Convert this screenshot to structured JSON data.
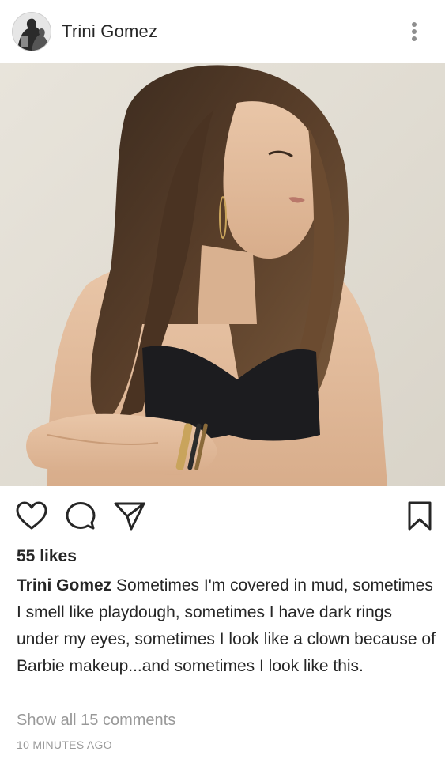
{
  "post": {
    "username": "Trini Gomez",
    "likes": "55 likes",
    "caption_user": "Trini Gomez",
    "caption_text": " Sometimes I'm covered in mud, sometimes I smell like playdough, sometimes I have dark rings under my eyes, sometimes I look like a clown because of Barbie makeup...and sometimes I look like this.",
    "comments_link": "Show all 15 comments",
    "timestamp": "10 MINUTES AGO"
  },
  "icons": {
    "more": "more-vertical-icon",
    "like": "heart-icon",
    "comment": "comment-bubble-icon",
    "share": "paper-plane-icon",
    "save": "bookmark-icon"
  },
  "colors": {
    "text": "#262626",
    "secondary_text": "#999999",
    "background": "#ffffff"
  }
}
